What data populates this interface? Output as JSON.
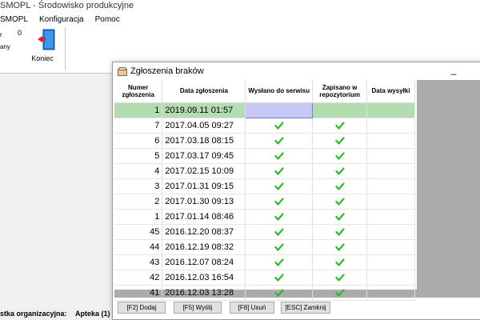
{
  "app": {
    "title": "SMOPL - Środowisko produkcyjne",
    "menu": [
      {
        "label": "SMOPL"
      },
      {
        "label": "Konfiguracja"
      },
      {
        "label": "Pomoc"
      }
    ],
    "ribbon": {
      "left_fragment_1": "r",
      "left_fragment_2": "any",
      "count": "0",
      "exit_label": "Koniec"
    },
    "status": {
      "label": "stka organizacyjna:",
      "value": "Apteka  (1)"
    }
  },
  "dialog": {
    "title": "Zgłoszenia braków",
    "minimize_glyph": "_",
    "columns": [
      "Numer zgłoszenia",
      "Data zgłoszenia",
      "Wysłano do serwisu",
      "Zapisano w repozytorium",
      "Data wysyłki"
    ],
    "rows": [
      {
        "num": "1",
        "date": "2019.09.11 01:57",
        "sent": false,
        "saved": false,
        "selected": true
      },
      {
        "num": "7",
        "date": "2017.04.05 09:27",
        "sent": true,
        "saved": true
      },
      {
        "num": "6",
        "date": "2017.03.18 08:15",
        "sent": true,
        "saved": true
      },
      {
        "num": "5",
        "date": "2017.03.17 09:45",
        "sent": true,
        "saved": true
      },
      {
        "num": "4",
        "date": "2017.02.15 10:09",
        "sent": true,
        "saved": true
      },
      {
        "num": "3",
        "date": "2017.01.31 09:15",
        "sent": true,
        "saved": true
      },
      {
        "num": "2",
        "date": "2017.01.30 09:13",
        "sent": true,
        "saved": true
      },
      {
        "num": "1",
        "date": "2017.01.14 08:46",
        "sent": true,
        "saved": true
      },
      {
        "num": "45",
        "date": "2016.12.20 08:37",
        "sent": true,
        "saved": true
      },
      {
        "num": "44",
        "date": "2016.12.19 08:32",
        "sent": true,
        "saved": true
      },
      {
        "num": "43",
        "date": "2016.12.07 08:24",
        "sent": true,
        "saved": true
      },
      {
        "num": "42",
        "date": "2016.12.03 16:54",
        "sent": true,
        "saved": true
      },
      {
        "num": "41",
        "date": "2016.12.03 13:28",
        "sent": true,
        "saved": true
      }
    ],
    "buttons": {
      "add": "[F2] Dodaj",
      "send": "[F5] Wyślij",
      "delete": "[F8] Usuń",
      "close": "[ESC] Zamknij"
    }
  },
  "colors": {
    "selected_row": "#b3dcb0",
    "edit_cell": "#c8c8f4",
    "check": "#2eb82e",
    "grid_bg": "#ababab"
  }
}
